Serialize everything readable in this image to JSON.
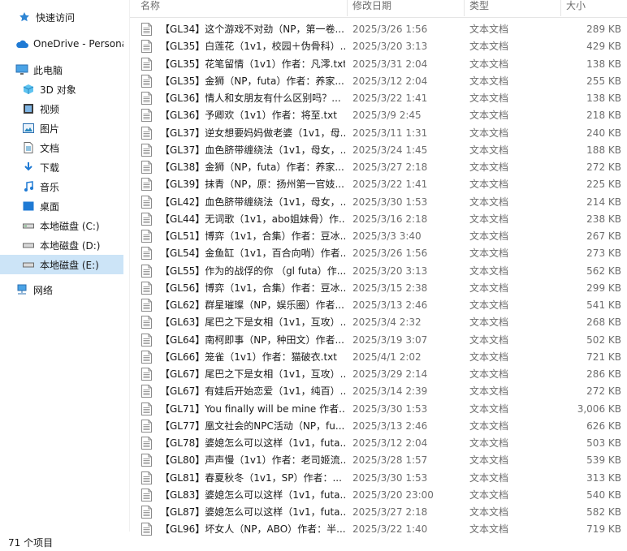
{
  "sidebar": {
    "items": [
      {
        "label": "快速访问",
        "icon": "star-icon"
      },
      {
        "label": "OneDrive - Persona",
        "icon": "cloud-icon"
      },
      {
        "label": "此电脑",
        "icon": "computer-icon"
      },
      {
        "label": "3D 对象",
        "icon": "cube-icon"
      },
      {
        "label": "视频",
        "icon": "video-icon"
      },
      {
        "label": "图片",
        "icon": "picture-icon"
      },
      {
        "label": "文档",
        "icon": "document-icon"
      },
      {
        "label": "下载",
        "icon": "download-icon"
      },
      {
        "label": "音乐",
        "icon": "music-icon"
      },
      {
        "label": "桌面",
        "icon": "desktop-icon"
      },
      {
        "label": "本地磁盘 (C:)",
        "icon": "drive-icon"
      },
      {
        "label": "本地磁盘 (D:)",
        "icon": "drive-icon"
      },
      {
        "label": "本地磁盘 (E:)",
        "icon": "drive-icon",
        "selected": true
      },
      {
        "label": "网络",
        "icon": "network-icon"
      }
    ]
  },
  "columns": {
    "name": "名称",
    "date": "修改日期",
    "type": "类型",
    "size": "大小"
  },
  "files": [
    {
      "name": "【GL34】这个游戏不对劲（NP，第一卷...",
      "date": "2025/3/26 1:56",
      "type": "文本文档",
      "size": "289 KB"
    },
    {
      "name": "【GL35】白莲花（1v1，校园＋伪骨科）...",
      "date": "2025/3/20 3:13",
      "type": "文本文档",
      "size": "429 KB"
    },
    {
      "name": "【GL35】花笔留情（1v1）作者：凡澪.txt",
      "date": "2025/3/31 2:04",
      "type": "文本文档",
      "size": "138 KB"
    },
    {
      "name": "【GL35】金狮（NP，futa）作者：养家...",
      "date": "2025/3/12 2:04",
      "type": "文本文档",
      "size": "255 KB"
    },
    {
      "name": "【GL36】情人和女朋友有什么区别吗？...",
      "date": "2025/3/22 1:41",
      "type": "文本文档",
      "size": "138 KB"
    },
    {
      "name": "【GL36】予卿欢（1v1）作者：将至.txt",
      "date": "2025/3/9 2:45",
      "type": "文本文档",
      "size": "218 KB"
    },
    {
      "name": "【GL37】逆女想要妈妈做老婆（1v1，母...",
      "date": "2025/3/11 1:31",
      "type": "文本文档",
      "size": "240 KB"
    },
    {
      "name": "【GL37】血色脐带缠绕法（1v1，母女，...",
      "date": "2025/3/24 1:45",
      "type": "文本文档",
      "size": "188 KB"
    },
    {
      "name": "【GL38】金狮（NP，futa）作者：养家...",
      "date": "2025/3/27 2:18",
      "type": "文本文档",
      "size": "272 KB"
    },
    {
      "name": "【GL39】抹青（NP，原：扬州第一官妓...",
      "date": "2025/3/22 1:41",
      "type": "文本文档",
      "size": "225 KB"
    },
    {
      "name": "【GL42】血色脐带缠绕法（1v1，母女，...",
      "date": "2025/3/30 1:53",
      "type": "文本文档",
      "size": "214 KB"
    },
    {
      "name": "【GL44】无词歌（1v1，abo姐妹骨）作...",
      "date": "2025/3/16 2:18",
      "type": "文本文档",
      "size": "238 KB"
    },
    {
      "name": "【GL51】博弈（1v1，合集）作者：豆冰...",
      "date": "2025/3/3 3:40",
      "type": "文本文档",
      "size": "267 KB"
    },
    {
      "name": "【GL54】金鱼缸（1v1，百合向哨）作者...",
      "date": "2025/3/26 1:56",
      "type": "文本文档",
      "size": "273 KB"
    },
    {
      "name": "【GL55】作为的战俘的你 （gl futa）作...",
      "date": "2025/3/20 3:13",
      "type": "文本文档",
      "size": "562 KB"
    },
    {
      "name": "【GL56】博弈（1v1，合集）作者：豆冰...",
      "date": "2025/3/15 2:38",
      "type": "文本文档",
      "size": "299 KB"
    },
    {
      "name": "【GL62】群星璀璨（NP，娱乐圈）作者...",
      "date": "2025/3/13 2:46",
      "type": "文本文档",
      "size": "541 KB"
    },
    {
      "name": "【GL63】尾巴之下是女相（1v1，互攻）...",
      "date": "2025/3/4 2:32",
      "type": "文本文档",
      "size": "268 KB"
    },
    {
      "name": "【GL64】南柯即事（NP，种田文）作者...",
      "date": "2025/3/19 3:07",
      "type": "文本文档",
      "size": "502 KB"
    },
    {
      "name": "【GL66】笼雀（1v1）作者：猫破衣.txt",
      "date": "2025/4/1 2:02",
      "type": "文本文档",
      "size": "721 KB"
    },
    {
      "name": "【GL67】尾巴之下是女相（1v1，互攻）...",
      "date": "2025/3/29 2:14",
      "type": "文本文档",
      "size": "286 KB"
    },
    {
      "name": "【GL67】有娃后开始恋爱（1v1，纯百）...",
      "date": "2025/3/14 2:39",
      "type": "文本文档",
      "size": "272 KB"
    },
    {
      "name": "【GL71】You finally will be mine 作者...",
      "date": "2025/3/30 1:53",
      "type": "文本文档",
      "size": "3,006 KB"
    },
    {
      "name": "【GL77】凰文社会的NPC活动（NP，fu...",
      "date": "2025/3/13 2:46",
      "type": "文本文档",
      "size": "626 KB"
    },
    {
      "name": "【GL78】婆媳怎么可以这样（1v1，futa...",
      "date": "2025/3/12 2:04",
      "type": "文本文档",
      "size": "503 KB"
    },
    {
      "name": "【GL80】声声慢（1v1）作者：老司姬流...",
      "date": "2025/3/28 1:57",
      "type": "文本文档",
      "size": "539 KB"
    },
    {
      "name": "【GL81】春夏秋冬（1v1，SP）作者：...",
      "date": "2025/3/30 1:53",
      "type": "文本文档",
      "size": "313 KB"
    },
    {
      "name": "【GL83】婆媳怎么可以这样（1v1，futa...",
      "date": "2025/3/20 23:00",
      "type": "文本文档",
      "size": "540 KB"
    },
    {
      "name": "【GL87】婆媳怎么可以这样（1v1，futa...",
      "date": "2025/3/27 2:18",
      "type": "文本文档",
      "size": "582 KB"
    },
    {
      "name": "【GL96】坏女人（NP，ABO）作者：半...",
      "date": "2025/3/22 1:40",
      "type": "文本文档",
      "size": "719 KB"
    }
  ],
  "status": {
    "item_count": "71 个项目"
  }
}
